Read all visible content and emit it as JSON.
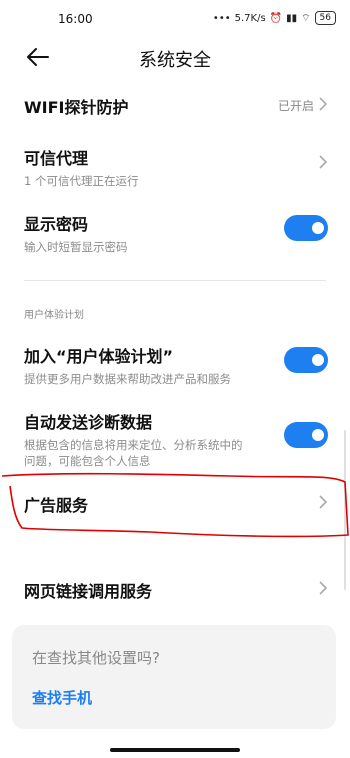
{
  "status": {
    "time": "16:00",
    "net_speed": "5.7K/s",
    "battery": "56"
  },
  "header": {
    "title": "系统安全"
  },
  "wifi_probe": {
    "title": "WIFI探针防护",
    "status": "已开启"
  },
  "trusted_agent": {
    "title": "可信代理",
    "subtitle": "1 个可信代理正在运行"
  },
  "show_password": {
    "title": "显示密码",
    "subtitle": "输入时短暂显示密码",
    "enabled": true
  },
  "section_label": "用户体验计划",
  "ux_plan": {
    "title": "加入“用户体验计划”",
    "subtitle": "提供更多用户数据来帮助改进产品和服务",
    "enabled": true
  },
  "diagnostics": {
    "title": "自动发送诊断数据",
    "subtitle_line1": "根据包含的信息将用来定位、分析系统中的",
    "subtitle_line2": "问题，可能包含个人信息",
    "enabled": true
  },
  "ad_service": {
    "title": "广告服务"
  },
  "web_link": {
    "title": "网页链接调用服务"
  },
  "help": {
    "question": "在查找其他设置吗?",
    "link": "查找手机"
  },
  "colors": {
    "accent": "#1e7ff0",
    "annotation": "#e00000"
  }
}
